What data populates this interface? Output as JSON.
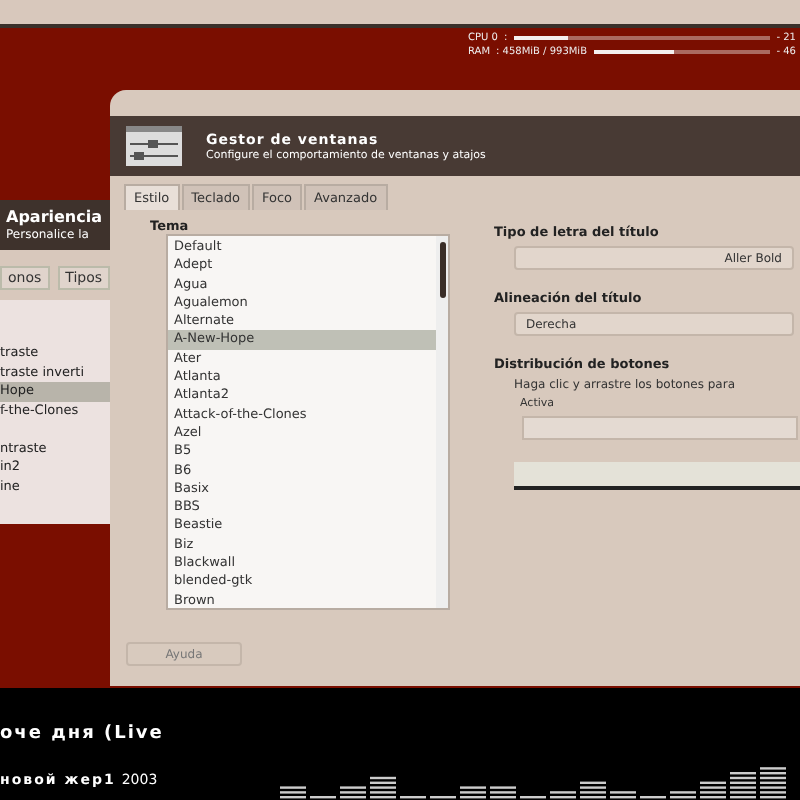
{
  "monitor": [
    {
      "label": "CPU 0",
      "value": ":",
      "level": 0.21,
      "reading": "- 21"
    },
    {
      "label": "RAM",
      "value": ": 458MiB / 993MiB",
      "level": 0.46,
      "reading": "- 46"
    }
  ],
  "back_window": {
    "title": "Apariencia",
    "subtitle": "Personalice la",
    "tabs": [
      {
        "label": "onos",
        "selected": false
      },
      {
        "label": "Tipos",
        "selected": false
      }
    ],
    "item_groups": [
      [
        {
          "label": "traste",
          "selected": false
        },
        {
          "label": "traste inverti",
          "selected": false
        },
        {
          "label": "Hope",
          "selected": true
        },
        {
          "label": "f-the-Clones",
          "selected": false
        }
      ],
      [
        {
          "label": "ntraste",
          "selected": false
        },
        {
          "label": "in2",
          "selected": false
        },
        {
          "label": "ine",
          "selected": false
        }
      ]
    ]
  },
  "window": {
    "title": "Gestor de ventanas",
    "subtitle": "Configure el comportamiento de ventanas y atajos",
    "tabs": [
      {
        "label": "Estilo",
        "selected": true
      },
      {
        "label": "Teclado",
        "selected": false
      },
      {
        "label": "Foco",
        "selected": false
      },
      {
        "label": "Avanzado",
        "selected": false
      }
    ],
    "theme_label": "Tema",
    "themes": [
      {
        "label": "Default",
        "selected": false
      },
      {
        "label": "Adept",
        "selected": false
      },
      {
        "label": "Agua",
        "selected": false
      },
      {
        "label": "Agualemon",
        "selected": false
      },
      {
        "label": "Alternate",
        "selected": false
      },
      {
        "label": "A-New-Hope",
        "selected": true
      },
      {
        "label": "Ater",
        "selected": false
      },
      {
        "label": "Atlanta",
        "selected": false
      },
      {
        "label": "Atlanta2",
        "selected": false
      },
      {
        "label": "Attack-of-the-Clones",
        "selected": false
      },
      {
        "label": "Azel",
        "selected": false
      },
      {
        "label": "B5",
        "selected": false
      },
      {
        "label": "B6",
        "selected": false
      },
      {
        "label": "Basix",
        "selected": false
      },
      {
        "label": "BBS",
        "selected": false
      },
      {
        "label": "Beastie",
        "selected": false
      },
      {
        "label": "Biz",
        "selected": false
      },
      {
        "label": "Blackwall",
        "selected": false
      },
      {
        "label": "blended-gtk",
        "selected": false
      },
      {
        "label": "Brown",
        "selected": false
      }
    ],
    "font_label": "Tipo de letra del título",
    "font_value": "Aller Bold",
    "align_label": "Alineación del título",
    "align_value": "Derecha",
    "buttons_label": "Distribución de botones",
    "buttons_hint": "Haga clic y arrastre los botones para",
    "active_label": "Activa",
    "help_button": "Ayuda"
  },
  "player": {
    "track": "оче дня  (Live",
    "album": "новой жер1",
    "year": "2003"
  }
}
